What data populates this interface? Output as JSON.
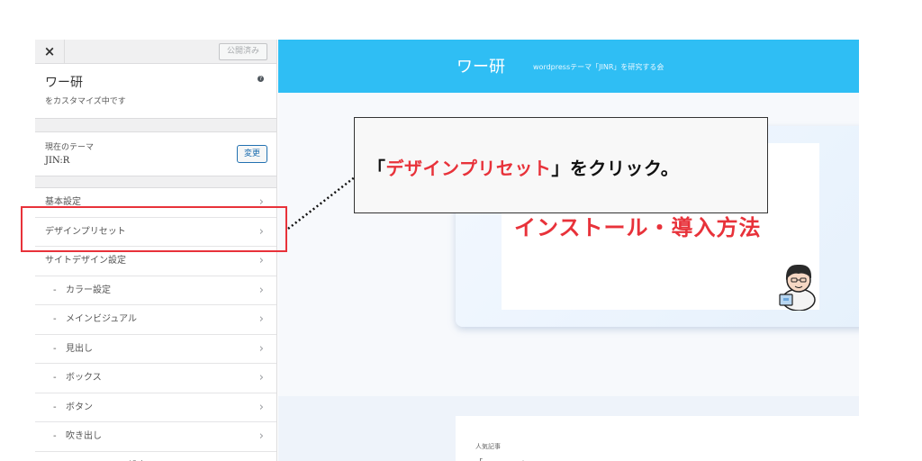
{
  "sidebar": {
    "close_label": "×",
    "publish_label": "公開済み",
    "site_title": "ワー研",
    "customizing_text": "をカスタマイズ中です",
    "help_label": "?",
    "theme": {
      "label": "現在のテーマ",
      "name": "JIN:R",
      "change_label": "変更"
    },
    "items": [
      {
        "label": "基本設定",
        "sub": false
      },
      {
        "label": "デザインプリセット",
        "sub": false
      },
      {
        "label": "サイトデザイン設定",
        "sub": false
      },
      {
        "label": "カラー設定",
        "sub": true
      },
      {
        "label": "メインビジュアル",
        "sub": true
      },
      {
        "label": "見出し",
        "sub": true
      },
      {
        "label": "ボックス",
        "sub": true
      },
      {
        "label": "ボタン",
        "sub": true
      },
      {
        "label": "吹き出し",
        "sub": true
      },
      {
        "label": "アニメーション設定",
        "sub": true
      }
    ],
    "sub_prefix": "-",
    "chevron": "›"
  },
  "preview": {
    "site_title": "ワー研",
    "tagline": "wordpressテーマ「JINR」を研究する会",
    "hero_heading": "インストール・導入方法",
    "popular_label": "人気記事",
    "popular_line": "「 　　　　　」"
  },
  "annotation": {
    "prefix": "「",
    "highlight": "デザインプリセット",
    "suffix": "」をクリック。"
  },
  "colors": {
    "header": "#2fbef4",
    "accent_red": "#e8323a",
    "link_blue": "#2271b1"
  }
}
